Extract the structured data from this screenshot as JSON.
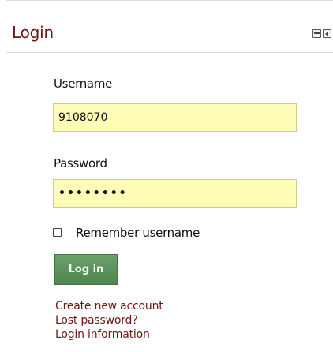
{
  "block": {
    "title": "Login",
    "icons": [
      "dock-icon",
      "hide-block-icon"
    ]
  },
  "form": {
    "username_label": "Username",
    "username_value": "9108070",
    "password_label": "Password",
    "password_value": "••••••••",
    "remember_label": "Remember username",
    "remember_checked": false,
    "submit_label": "Log in"
  },
  "links": {
    "create_account": "Create new account",
    "lost_password": "Lost password?",
    "login_information": "Login information"
  },
  "colors": {
    "title": "#6b1a12",
    "link": "#6b1a12",
    "field_bg": "#fdfdb8",
    "button": "#5a935a"
  }
}
